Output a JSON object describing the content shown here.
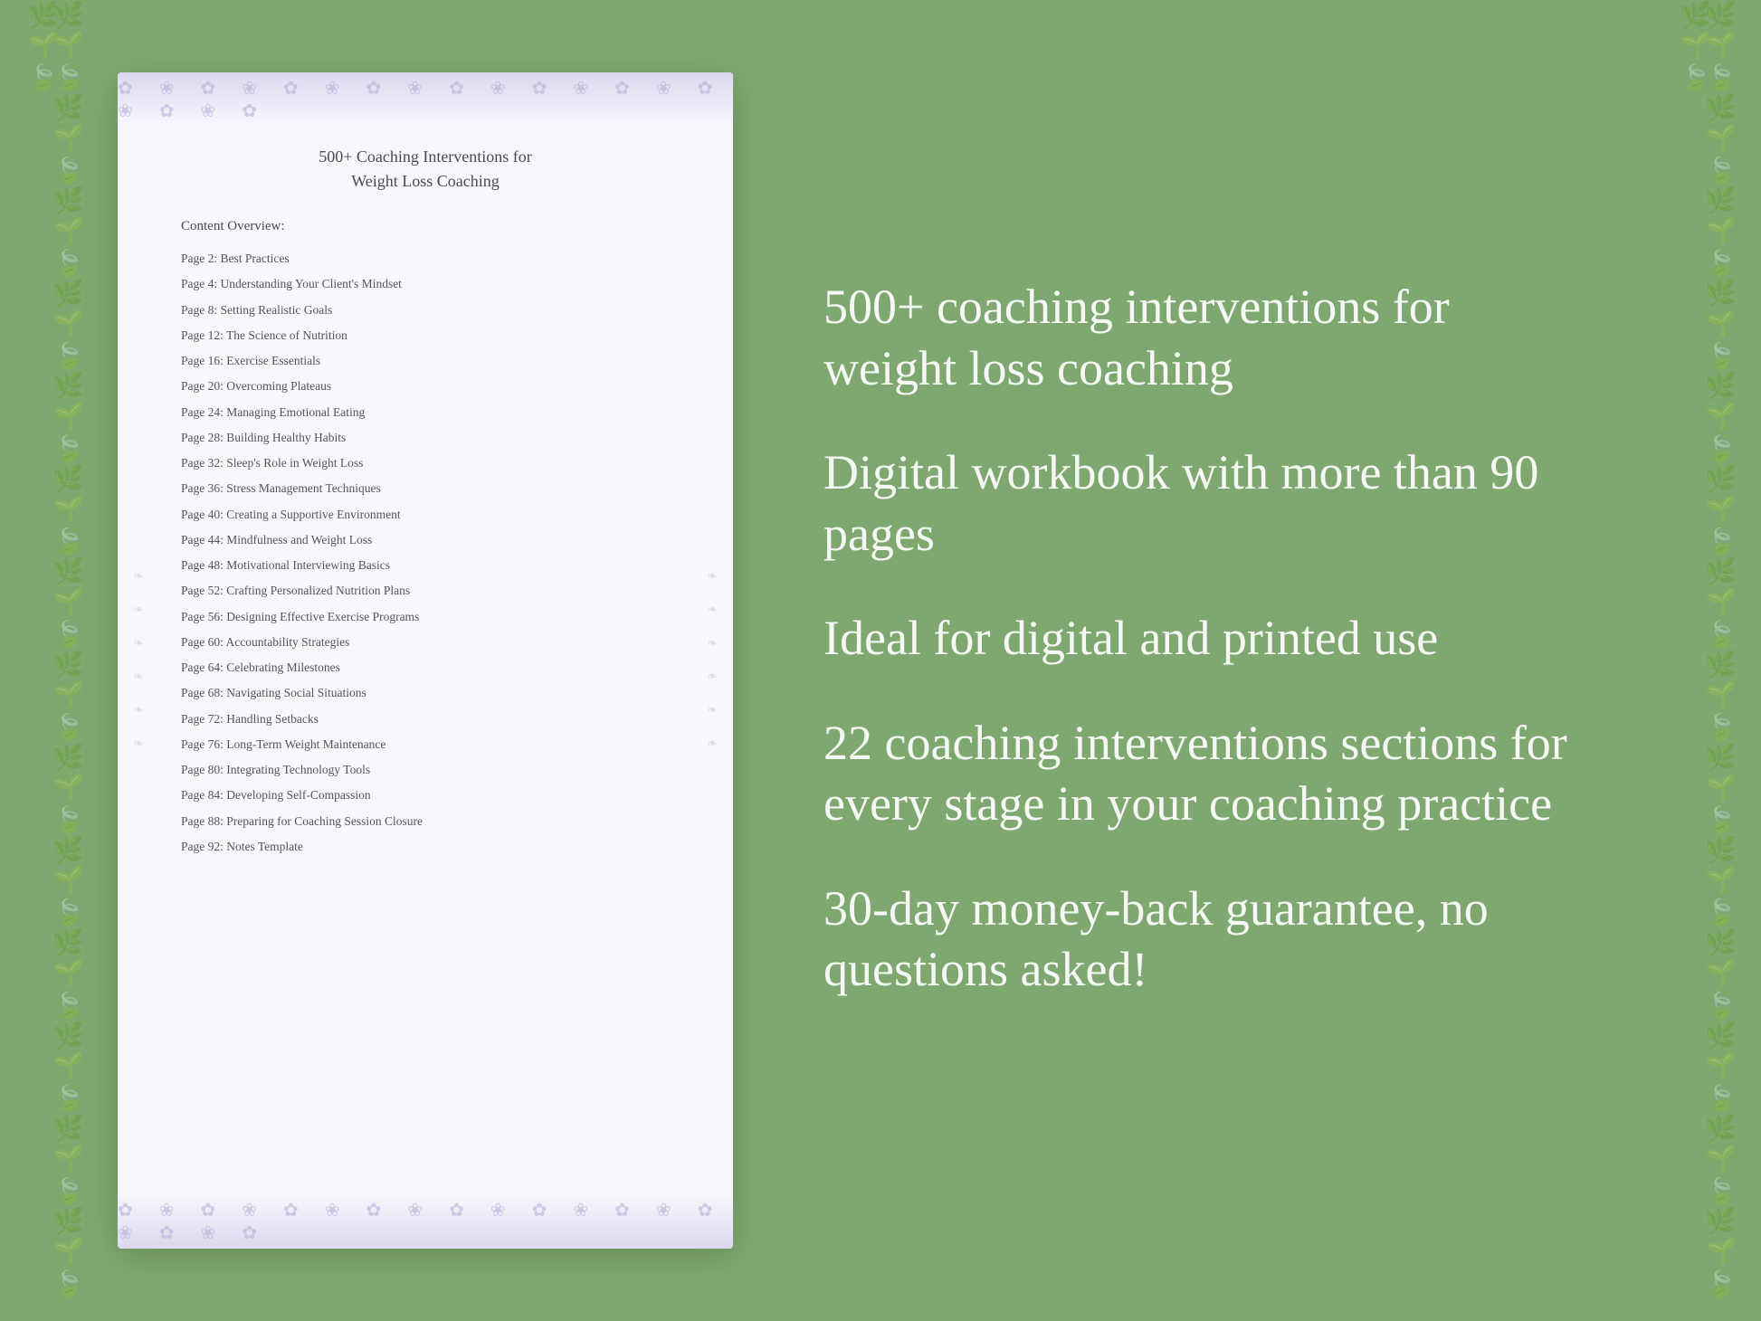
{
  "document": {
    "title_line1": "500+ Coaching Interventions for",
    "title_line2": "Weight Loss Coaching",
    "content_overview_label": "Content Overview:",
    "toc_items": [
      {
        "page": "Page  2:",
        "title": "Best Practices"
      },
      {
        "page": "Page  4:",
        "title": "Understanding Your Client's Mindset"
      },
      {
        "page": "Page  8:",
        "title": "Setting Realistic Goals"
      },
      {
        "page": "Page 12:",
        "title": "The Science of Nutrition"
      },
      {
        "page": "Page 16:",
        "title": "Exercise Essentials"
      },
      {
        "page": "Page 20:",
        "title": "Overcoming Plateaus"
      },
      {
        "page": "Page 24:",
        "title": "Managing Emotional Eating"
      },
      {
        "page": "Page 28:",
        "title": "Building Healthy Habits"
      },
      {
        "page": "Page 32:",
        "title": "Sleep's Role in Weight Loss"
      },
      {
        "page": "Page 36:",
        "title": "Stress Management Techniques"
      },
      {
        "page": "Page 40:",
        "title": "Creating a Supportive Environment"
      },
      {
        "page": "Page 44:",
        "title": "Mindfulness and Weight Loss"
      },
      {
        "page": "Page 48:",
        "title": "Motivational Interviewing Basics"
      },
      {
        "page": "Page 52:",
        "title": "Crafting Personalized Nutrition Plans"
      },
      {
        "page": "Page 56:",
        "title": "Designing Effective Exercise Programs"
      },
      {
        "page": "Page 60:",
        "title": "Accountability Strategies"
      },
      {
        "page": "Page 64:",
        "title": "Celebrating Milestones"
      },
      {
        "page": "Page 68:",
        "title": "Navigating Social Situations"
      },
      {
        "page": "Page 72:",
        "title": "Handling Setbacks"
      },
      {
        "page": "Page 76:",
        "title": "Long-Term Weight Maintenance"
      },
      {
        "page": "Page 80:",
        "title": "Integrating Technology Tools"
      },
      {
        "page": "Page 84:",
        "title": "Developing Self-Compassion"
      },
      {
        "page": "Page 88:",
        "title": "Preparing for Coaching Session Closure"
      },
      {
        "page": "Page 92:",
        "title": "Notes Template"
      }
    ]
  },
  "info_panel": {
    "blocks": [
      {
        "text": "500+ coaching interventions for weight loss coaching"
      },
      {
        "text": "Digital workbook with more than 90 pages"
      },
      {
        "text": "Ideal for digital and printed use"
      },
      {
        "text": "22 coaching interventions sections for every stage in your coaching practice"
      },
      {
        "text": "30-day money-back guarantee, no questions asked!"
      }
    ]
  }
}
